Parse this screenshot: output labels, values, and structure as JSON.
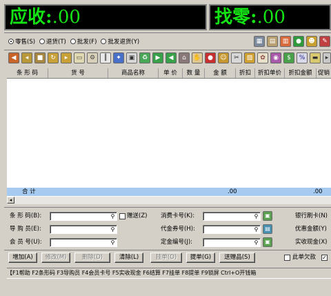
{
  "display": {
    "receivable_label": "应收:",
    "receivable_value": ".00",
    "change_label": "找零:",
    "change_value": ".00",
    "led_color": "#14e314"
  },
  "mode_radios": [
    {
      "label": "零售(S)",
      "selected": true
    },
    {
      "label": "退货(T)",
      "selected": false
    },
    {
      "label": "批发(F)",
      "selected": false
    },
    {
      "label": "批发退货(Y)",
      "selected": false
    }
  ],
  "toolbar_right_icons": [
    "calculator-icon",
    "register-icon",
    "calendar-icon",
    "globe-icon",
    "people-icon",
    "notes-icon"
  ],
  "toolbar_icons": [
    "open-icon",
    "back-icon",
    "lock-icon",
    "refresh-icon",
    "forward-icon",
    "copy-icon",
    "gear-icon",
    "barcode-icon",
    "figure-icon",
    "form-icon",
    "recycle-icon",
    "next-icon",
    "prev-icon",
    "home-icon",
    "hand-icon",
    "apple-icon",
    "user-icon",
    "scissors-icon",
    "image-icon",
    "gift-icon",
    "color-icon",
    "money-icon",
    "discount-icon",
    "report-icon"
  ],
  "table": {
    "headers": [
      "条 形 码",
      "货 号",
      "商品名称",
      "单 价",
      "数 量",
      "金 额",
      "折扣",
      "折扣单价",
      "折扣金额",
      "促销"
    ],
    "total_label": "合 计",
    "total_amount": ".00",
    "total_discount_amount": ".00"
  },
  "form": {
    "barcode_label": "条 形 码(B):",
    "guide_label": "导 购 员(E):",
    "member_label": "会 员 号(U):",
    "gift_label": "赠送(Z)",
    "consume_card_label": "消费卡号(K):",
    "voucher_label": "代金券号(H):",
    "deposit_label": "定金编号(J):",
    "bank_card_label": "银行刷卡(N)",
    "discount_amount_label": "优惠金额(Y)",
    "cash_label": "实收现金(X)",
    "owed_label": "此单欠款"
  },
  "buttons": [
    {
      "label": "增加(A)",
      "disabled": false
    },
    {
      "label": "修改(M)",
      "disabled": true
    },
    {
      "label": "删除(D)",
      "disabled": true
    },
    {
      "label": "清除(L)",
      "disabled": false
    },
    {
      "label": "挂单(O)",
      "disabled": true
    },
    {
      "label": "提单(G)",
      "disabled": false
    },
    {
      "label": "送赠品(S)",
      "disabled": false
    }
  ],
  "status_bar": "【F1帮助 F2条形码 F3导购员 F4会员卡号 F5实收现金 F6结算 F7挂单 F8提单 F9锁屏 Ctrl+O开钱箱"
}
